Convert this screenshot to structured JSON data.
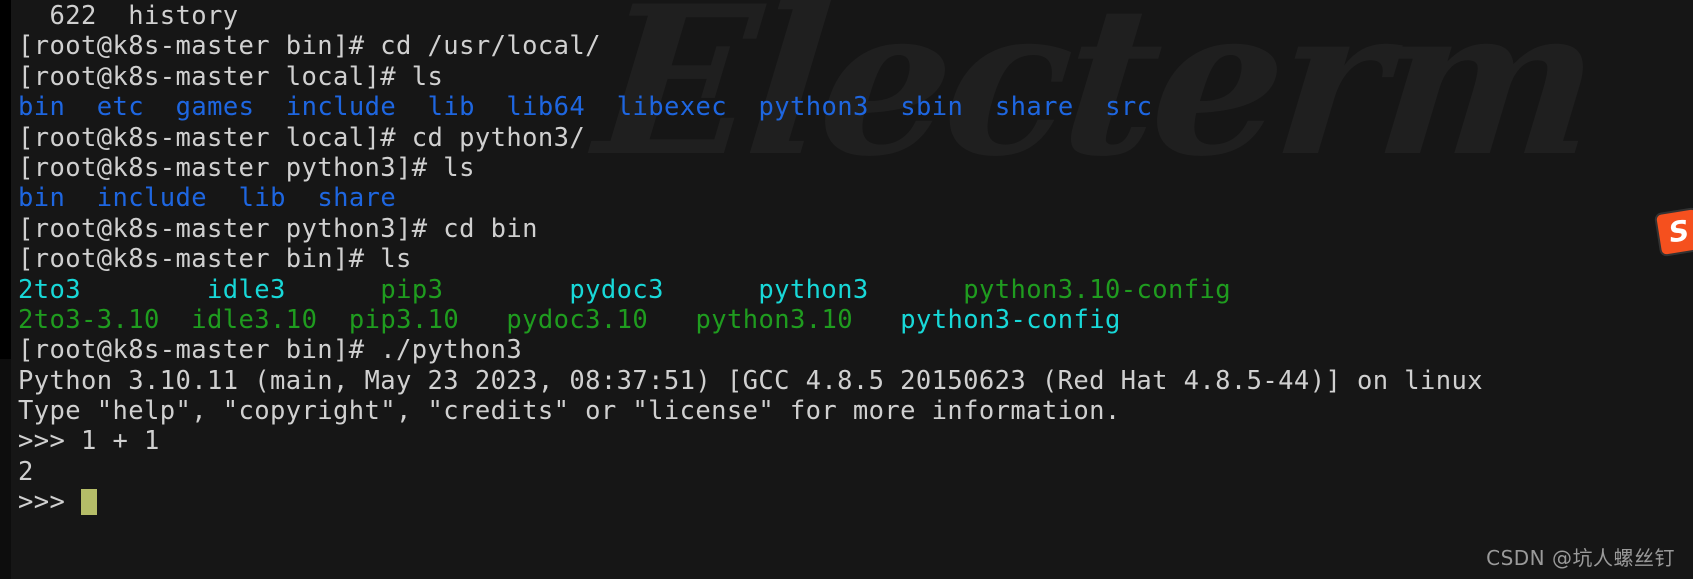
{
  "app": {
    "name": "Electerm",
    "watermark_text": "Electerm"
  },
  "terminal": {
    "background_color": "#161616",
    "foreground_color": "#cfcfcf",
    "cursor_color": "#b5bd68",
    "colors": {
      "directory_blue": "#1e66e0",
      "symlink_cyan": "#18d8d8",
      "executable_green": "#1f9c1f",
      "text_white": "#d0d0d0"
    },
    "lines": [
      {
        "id": "history-entry",
        "segments": [
          {
            "text": "  622  history",
            "color": "white"
          }
        ]
      },
      {
        "id": "prompt-cd-usr-local",
        "segments": [
          {
            "text": "[root@k8s-master bin]# cd /usr/local/",
            "color": "white"
          }
        ]
      },
      {
        "id": "prompt-ls-local",
        "segments": [
          {
            "text": "[root@k8s-master local]# ls",
            "color": "white"
          }
        ]
      },
      {
        "id": "ls-output-local",
        "segments": [
          {
            "text": "bin",
            "color": "blue"
          },
          {
            "text": "  ",
            "color": "white"
          },
          {
            "text": "etc",
            "color": "blue"
          },
          {
            "text": "  ",
            "color": "white"
          },
          {
            "text": "games",
            "color": "blue"
          },
          {
            "text": "  ",
            "color": "white"
          },
          {
            "text": "include",
            "color": "blue"
          },
          {
            "text": "  ",
            "color": "white"
          },
          {
            "text": "lib",
            "color": "blue"
          },
          {
            "text": "  ",
            "color": "white"
          },
          {
            "text": "lib64",
            "color": "blue"
          },
          {
            "text": "  ",
            "color": "white"
          },
          {
            "text": "libexec",
            "color": "blue"
          },
          {
            "text": "  ",
            "color": "white"
          },
          {
            "text": "python3",
            "color": "blue"
          },
          {
            "text": "  ",
            "color": "white"
          },
          {
            "text": "sbin",
            "color": "blue"
          },
          {
            "text": "  ",
            "color": "white"
          },
          {
            "text": "share",
            "color": "blue"
          },
          {
            "text": "  ",
            "color": "white"
          },
          {
            "text": "src",
            "color": "blue"
          }
        ]
      },
      {
        "id": "prompt-cd-python3",
        "segments": [
          {
            "text": "[root@k8s-master local]# cd python3/",
            "color": "white"
          }
        ]
      },
      {
        "id": "prompt-ls-python3",
        "segments": [
          {
            "text": "[root@k8s-master python3]# ls",
            "color": "white"
          }
        ]
      },
      {
        "id": "ls-output-python3",
        "segments": [
          {
            "text": "bin",
            "color": "blue"
          },
          {
            "text": "  ",
            "color": "white"
          },
          {
            "text": "include",
            "color": "blue"
          },
          {
            "text": "  ",
            "color": "white"
          },
          {
            "text": "lib",
            "color": "blue"
          },
          {
            "text": "  ",
            "color": "white"
          },
          {
            "text": "share",
            "color": "blue"
          }
        ]
      },
      {
        "id": "prompt-cd-bin",
        "segments": [
          {
            "text": "[root@k8s-master python3]# cd bin",
            "color": "white"
          }
        ]
      },
      {
        "id": "prompt-ls-bin",
        "segments": [
          {
            "text": "[root@k8s-master bin]# ls",
            "color": "white"
          }
        ]
      },
      {
        "id": "ls-output-bin-row1",
        "segments": [
          {
            "text": "2to3",
            "color": "cyan"
          },
          {
            "text": "        ",
            "color": "white"
          },
          {
            "text": "idle3",
            "color": "cyan"
          },
          {
            "text": "      ",
            "color": "white"
          },
          {
            "text": "pip3",
            "color": "green"
          },
          {
            "text": "        ",
            "color": "white"
          },
          {
            "text": "pydoc3",
            "color": "cyan"
          },
          {
            "text": "      ",
            "color": "white"
          },
          {
            "text": "python3",
            "color": "cyan"
          },
          {
            "text": "      ",
            "color": "white"
          },
          {
            "text": "python3.10-config",
            "color": "green"
          }
        ]
      },
      {
        "id": "ls-output-bin-row2",
        "segments": [
          {
            "text": "2to3-3.10",
            "color": "green"
          },
          {
            "text": "  ",
            "color": "white"
          },
          {
            "text": "idle3.10",
            "color": "green"
          },
          {
            "text": "  ",
            "color": "white"
          },
          {
            "text": "pip3.10",
            "color": "green"
          },
          {
            "text": "   ",
            "color": "white"
          },
          {
            "text": "pydoc3.10",
            "color": "green"
          },
          {
            "text": "   ",
            "color": "white"
          },
          {
            "text": "python3.10",
            "color": "green"
          },
          {
            "text": "   ",
            "color": "white"
          },
          {
            "text": "python3-config",
            "color": "cyan"
          }
        ]
      },
      {
        "id": "prompt-run-python3",
        "segments": [
          {
            "text": "[root@k8s-master bin]# ./python3",
            "color": "white"
          }
        ]
      },
      {
        "id": "python-version-banner",
        "segments": [
          {
            "text": "Python 3.10.11 (main, May 23 2023, 08:37:51) [GCC 4.8.5 20150623 (Red Hat 4.8.5-44)] on linux",
            "color": "white"
          }
        ]
      },
      {
        "id": "python-help-banner",
        "segments": [
          {
            "text": "Type \"help\", \"copyright\", \"credits\" or \"license\" for more information.",
            "color": "white"
          }
        ]
      },
      {
        "id": "python-input-1plus1",
        "segments": [
          {
            "text": ">>> 1 + 1",
            "color": "white"
          }
        ]
      },
      {
        "id": "python-output-2",
        "segments": [
          {
            "text": "2",
            "color": "white"
          }
        ]
      }
    ],
    "final_prompt": ">>> "
  },
  "overlays": {
    "sogou_ime": {
      "name": "sogou-ime-icon",
      "glyph": "S",
      "color": "#f5501e"
    },
    "csdn_watermark": "CSDN @坑人螺丝钉"
  }
}
